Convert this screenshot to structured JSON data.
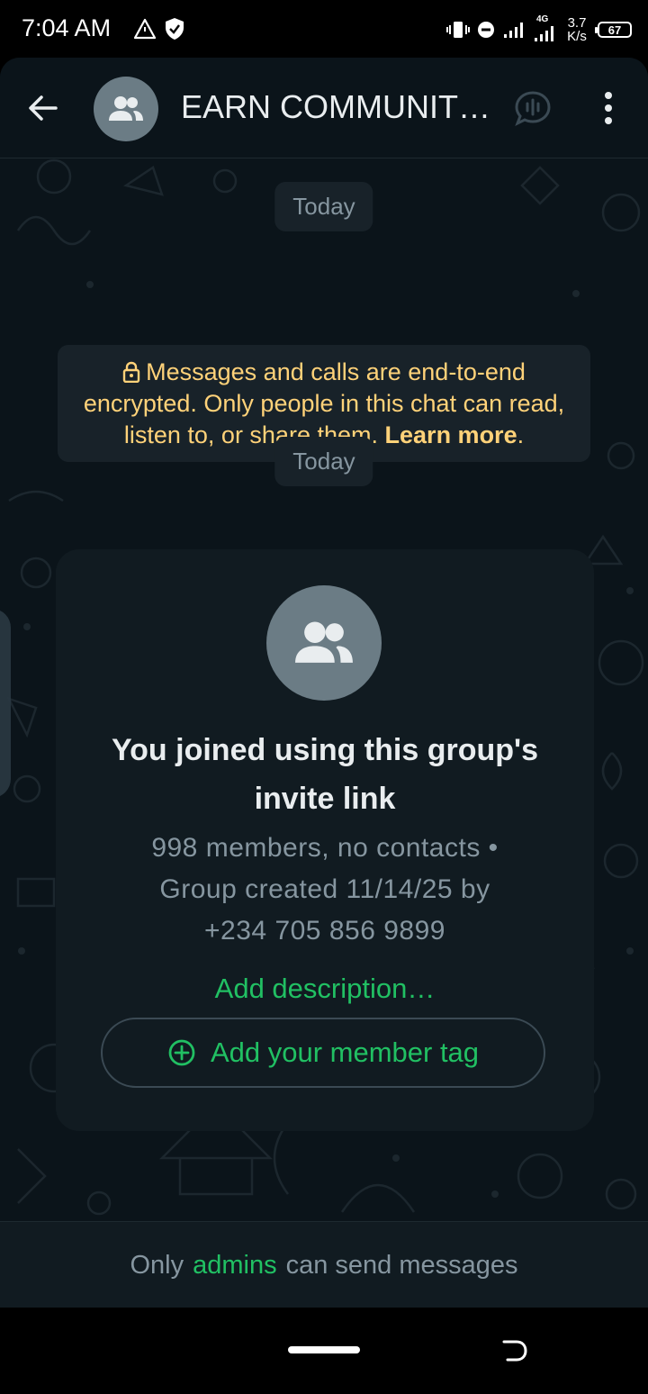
{
  "status_bar": {
    "time": "7:04 AM",
    "network_type": "4G",
    "speed_value": "3.7",
    "speed_unit": "K/s",
    "battery": "67",
    "icons": [
      "alert-triangle-icon",
      "shield-check-icon",
      "vibrate-icon",
      "dnd-icon",
      "signal-icon",
      "signal-4g-icon"
    ]
  },
  "header": {
    "title": "EARN COMMUNIT…",
    "icons": [
      "back-arrow-icon",
      "group-avatar-icon",
      "voice-chat-icon",
      "more-options-icon"
    ]
  },
  "chat": {
    "date_chip_1": "Today",
    "encryption_text": "Messages and calls are end-to-end encrypted. Only people in this chat can read, listen to, or share them.",
    "encryption_link": "Learn more",
    "date_chip_2": "Today"
  },
  "group_card": {
    "joined_text": "You joined using this group's invite link",
    "members_line": "998 members, no contacts •",
    "created_line": "Group created 11/14/25 by",
    "creator": "+234 705 856 9899",
    "add_description": "Add description…",
    "member_tag_button": "Add your member tag"
  },
  "footer": {
    "prefix": "Only",
    "admins_link": "admins",
    "suffix": "can send messages"
  },
  "colors": {
    "background": "#0b141a",
    "card": "#111b21",
    "chip": "#182229",
    "accent_green": "#21c063",
    "encryption_yellow": "#ffd279",
    "muted_text": "#8696a0",
    "avatar_gray": "#6b7c85"
  }
}
